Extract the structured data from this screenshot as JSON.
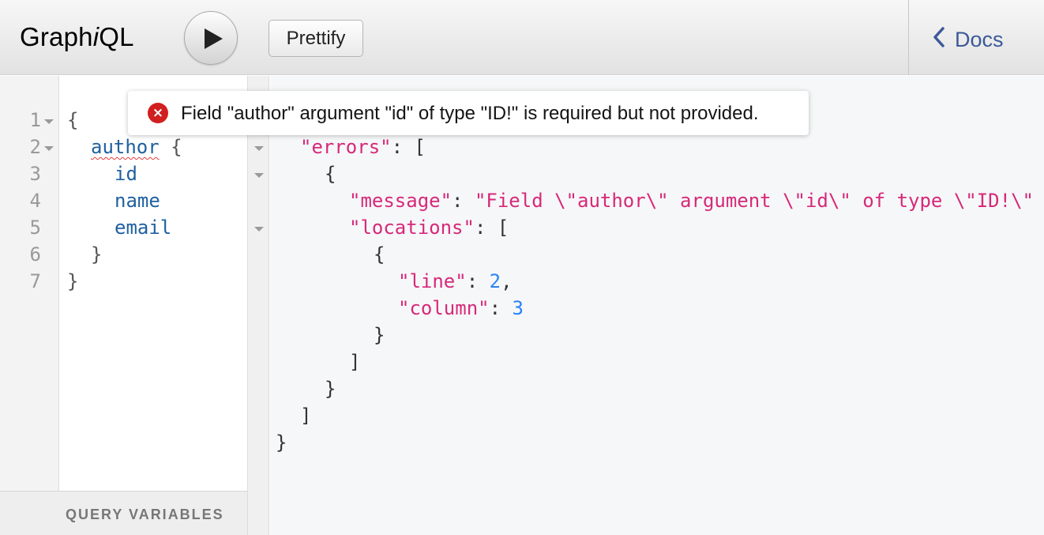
{
  "toolbar": {
    "logo_prefix": "Graph",
    "logo_italic": "i",
    "logo_suffix": "QL",
    "run_label": "Execute Query",
    "prettify_label": "Prettify",
    "docs_label": "Docs"
  },
  "query_editor": {
    "line_numbers": [
      "1",
      "2",
      "3",
      "4",
      "5",
      "6",
      "7"
    ],
    "lines": {
      "l1": "{",
      "l2_field": "author",
      "l2_brace": " {",
      "l3": "id",
      "l4": "name",
      "l5": "email",
      "l6": "}",
      "l7": "}"
    }
  },
  "query_variables_label": "QUERY VARIABLES",
  "error_tooltip": {
    "icon": "error-circle-icon",
    "message": "Field \"author\" argument \"id\" of type \"ID!\" is required but not provided."
  },
  "result": {
    "errors_key": "\"errors\"",
    "message_key": "\"message\"",
    "message_value": "\"Field \\\"author\\\" argument \\\"id\\\" of type \\\"ID!\\\" is required but not provided.\"",
    "locations_key": "\"locations\"",
    "line_key": "\"line\"",
    "line_value": "2",
    "column_key": "\"column\"",
    "column_value": "3"
  },
  "colors": {
    "accent_link": "#3b5998",
    "json_key": "#d6297a",
    "json_number": "#2882f9",
    "graphql_field": "#1f61a0",
    "error_red": "#d11f1f"
  }
}
